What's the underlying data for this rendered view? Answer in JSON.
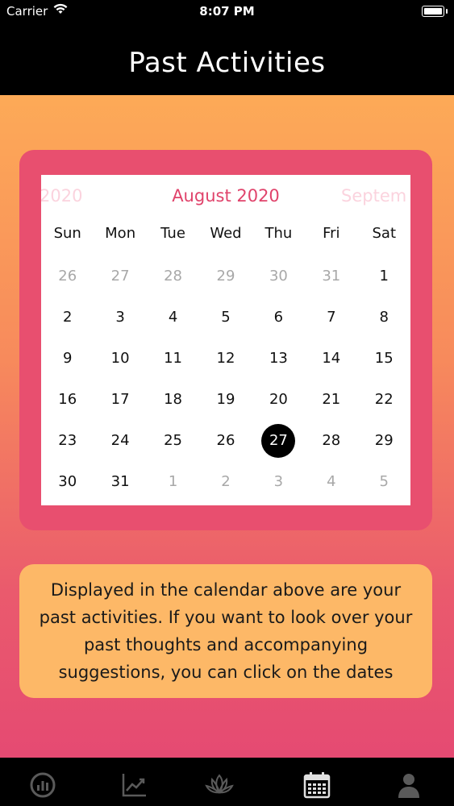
{
  "status_bar": {
    "carrier": "Carrier",
    "time": "8:07 PM"
  },
  "nav": {
    "title": "Past Activities"
  },
  "calendar": {
    "prev_month": "2020",
    "current_month": "August 2020",
    "next_month": "Septem",
    "weekdays": [
      "Sun",
      "Mon",
      "Tue",
      "Wed",
      "Thu",
      "Fri",
      "Sat"
    ],
    "weeks": [
      [
        {
          "d": "26",
          "muted": true
        },
        {
          "d": "27",
          "muted": true
        },
        {
          "d": "28",
          "muted": true
        },
        {
          "d": "29",
          "muted": true
        },
        {
          "d": "30",
          "muted": true
        },
        {
          "d": "31",
          "muted": true
        },
        {
          "d": "1"
        }
      ],
      [
        {
          "d": "2"
        },
        {
          "d": "3"
        },
        {
          "d": "4"
        },
        {
          "d": "5"
        },
        {
          "d": "6"
        },
        {
          "d": "7"
        },
        {
          "d": "8"
        }
      ],
      [
        {
          "d": "9"
        },
        {
          "d": "10"
        },
        {
          "d": "11"
        },
        {
          "d": "12"
        },
        {
          "d": "13"
        },
        {
          "d": "14"
        },
        {
          "d": "15"
        }
      ],
      [
        {
          "d": "16"
        },
        {
          "d": "17"
        },
        {
          "d": "18"
        },
        {
          "d": "19"
        },
        {
          "d": "20"
        },
        {
          "d": "21"
        },
        {
          "d": "22"
        }
      ],
      [
        {
          "d": "23"
        },
        {
          "d": "24"
        },
        {
          "d": "25"
        },
        {
          "d": "26"
        },
        {
          "d": "27",
          "selected": true
        },
        {
          "d": "28"
        },
        {
          "d": "29"
        }
      ],
      [
        {
          "d": "30"
        },
        {
          "d": "31"
        },
        {
          "d": "1",
          "muted": true
        },
        {
          "d": "2",
          "muted": true
        },
        {
          "d": "3",
          "muted": true
        },
        {
          "d": "4",
          "muted": true
        },
        {
          "d": "5",
          "muted": true
        }
      ]
    ]
  },
  "info": {
    "text": "Displayed in the calendar above are your past activities. If you want to look over your past thoughts and accompanying suggestions, you can click on the dates"
  },
  "tab_bar": {
    "items": [
      {
        "icon": "dashboard-gauge-icon",
        "active": false
      },
      {
        "icon": "trend-chart-icon",
        "active": false
      },
      {
        "icon": "lotus-icon",
        "active": false
      },
      {
        "icon": "calendar-icon",
        "active": true
      },
      {
        "icon": "person-icon",
        "active": false
      }
    ]
  },
  "colors": {
    "accent": "#e0436b",
    "frame": "#e84f6f",
    "info_bg": "#fdb867",
    "gradient_top": "#fdaa57",
    "gradient_bottom": "#e54a72"
  }
}
